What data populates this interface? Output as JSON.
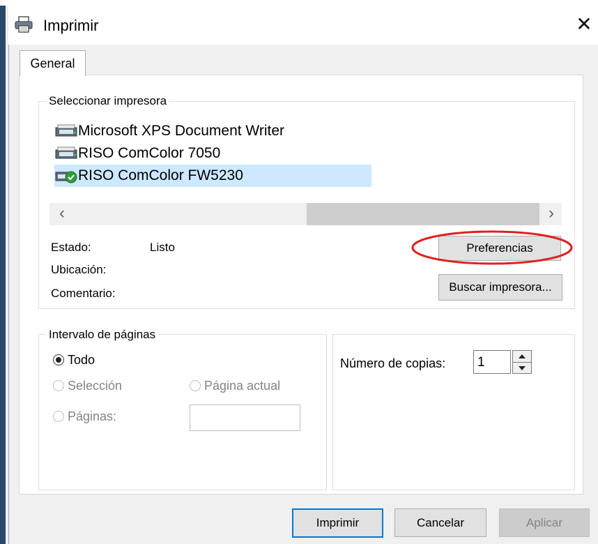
{
  "window": {
    "title": "Imprimir",
    "close_glyph": "✕",
    "icon": "printer-icon"
  },
  "tabs": [
    {
      "label": "General",
      "selected": true
    }
  ],
  "printer_group": {
    "legend": "Seleccionar impresora",
    "printers": [
      {
        "name": "Microsoft XPS Document Writer",
        "icon": "printer-icon",
        "selected": false,
        "default": false
      },
      {
        "name": "RISO ComColor 7050",
        "icon": "printer-icon",
        "selected": false,
        "default": false
      },
      {
        "name": "RISO ComColor FW5230",
        "icon": "default-printer-icon",
        "selected": true,
        "default": true
      }
    ],
    "scroll_left": "‹",
    "scroll_right": "›",
    "status_label": "Estado:",
    "status_value": "Listo",
    "location_label": "Ubicación:",
    "comment_label": "Comentario:",
    "preferences_button": "Preferencias",
    "find_printer_button": "Buscar impresora..."
  },
  "page_range": {
    "legend": "Intervalo de páginas",
    "all_label": "Todo",
    "selection_label": "Selección",
    "current_page_label": "Página actual",
    "pages_label": "Páginas:",
    "pages_value": "",
    "selected_option": "Todo"
  },
  "copies": {
    "label": "Número de copias:",
    "value": "1"
  },
  "buttons": {
    "print": "Imprimir",
    "cancel": "Cancelar",
    "apply": "Aplicar"
  },
  "colors": {
    "highlight_ellipse": "#e02020",
    "selection_bg": "#cde8ff",
    "default_button_border": "#0078d7",
    "default_printer_badge": "#2e9c3a"
  }
}
